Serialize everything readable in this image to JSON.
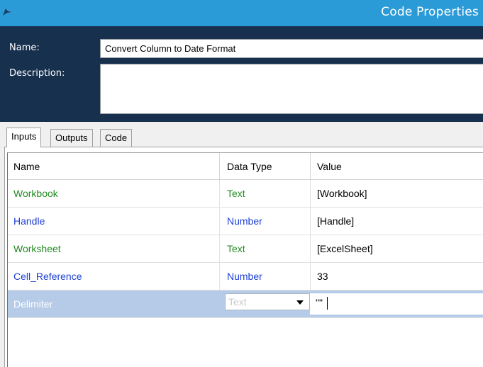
{
  "window": {
    "title": "Code Properties"
  },
  "header": {
    "name_label": "Name:",
    "name_value": "Convert Column to Date Format",
    "description_label": "Description:",
    "description_value": ""
  },
  "tabs": [
    {
      "label": "Inputs",
      "active": true
    },
    {
      "label": "Outputs",
      "active": false
    },
    {
      "label": "Code",
      "active": false
    }
  ],
  "grid": {
    "columns": [
      "Name",
      "Data Type",
      "Value"
    ],
    "rows": [
      {
        "name": "Workbook",
        "type": "Text",
        "value": "[Workbook]",
        "color": "#228b22"
      },
      {
        "name": "Handle",
        "type": "Number",
        "value": "[Handle]",
        "color": "#1c3fd6"
      },
      {
        "name": "Worksheet",
        "type": "Text",
        "value": "[ExcelSheet]",
        "color": "#228b22"
      },
      {
        "name": "Cell_Reference",
        "type": "Number",
        "value": "33",
        "color": "#1c3fd6"
      },
      {
        "name": "Delimiter",
        "type": "Text",
        "value": "\"\"",
        "selected": true
      }
    ]
  },
  "colors": {
    "titlebar": "#2b9bd8",
    "header_bg": "#17304e",
    "text_type_color": "#228b22",
    "number_type_color": "#1c3fd6",
    "selection": "#b6cbe8"
  }
}
